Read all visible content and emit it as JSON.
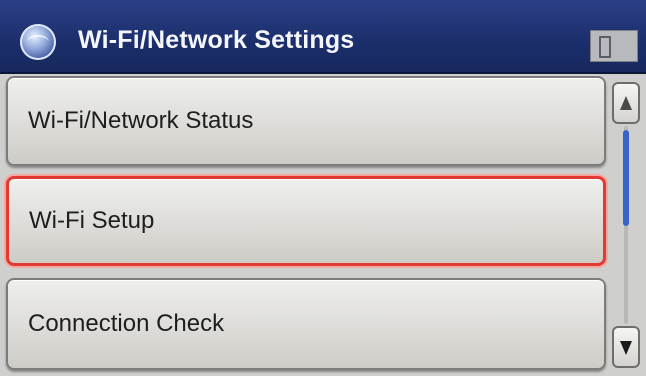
{
  "header": {
    "title": "Wi-Fi/Network Settings",
    "icon": "globe-icon",
    "status_icon": "status-indicator-icon"
  },
  "menu": {
    "items": [
      {
        "label": "Wi-Fi/Network Status",
        "selected": false
      },
      {
        "label": "Wi-Fi Setup",
        "selected": true
      },
      {
        "label": "Connection Check",
        "selected": false
      }
    ]
  },
  "scrollbar": {
    "up_icon": "scroll-up-arrow-icon",
    "down_icon": "scroll-down-arrow-icon",
    "position_fraction": 0.0,
    "visible_fraction": 0.5
  },
  "colors": {
    "header_bg": "#1d2f6d",
    "selection_border": "#e23a32",
    "scroll_thumb": "#3a63c7"
  }
}
